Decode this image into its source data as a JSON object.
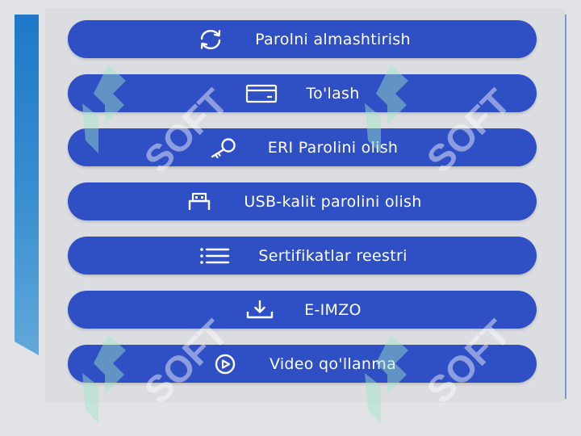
{
  "menu": {
    "items": [
      {
        "label": "Parolni almashtirish",
        "icon": "refresh-icon"
      },
      {
        "label": "To'lash",
        "icon": "payment-card-icon"
      },
      {
        "label": "ERI Parolini olish",
        "icon": "key-icon"
      },
      {
        "label": "USB-kalit parolini olish",
        "icon": "usb-key-icon"
      },
      {
        "label": "Sertifikatlar reestri",
        "icon": "list-icon"
      },
      {
        "label": "E-IMZO",
        "icon": "download-icon"
      },
      {
        "label": "Video qo'llanma",
        "icon": "play-circle-icon"
      }
    ]
  },
  "watermark": {
    "text": "SOFT"
  },
  "colors": {
    "button": "#2f4fc4",
    "button_text": "#ffffff",
    "background": "#e2e3e7",
    "accent_bar": "#1f78c8",
    "watermark": "#9fe6c8"
  }
}
